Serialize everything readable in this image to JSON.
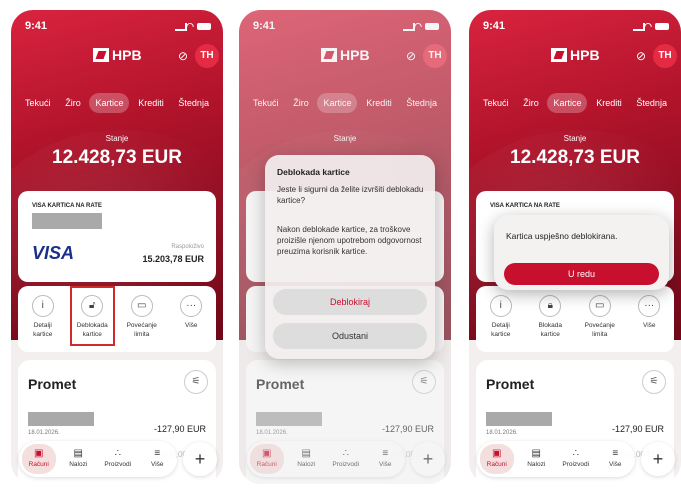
{
  "status": {
    "time": "9:41"
  },
  "header": {
    "logo_text": "HPB",
    "avatar_initials": "TH"
  },
  "tabs": [
    "Tekući",
    "Žiro",
    "Kartice",
    "Krediti",
    "Štednja"
  ],
  "balance": {
    "label": "Stanje",
    "amount": "12.428,73 EUR"
  },
  "card": {
    "title": "VISA KARTICA NA RATE",
    "brand": "VISA",
    "available_label": "Raspoloživo",
    "available_amount": "15.203,78 EUR"
  },
  "actions": [
    {
      "label": "Detalji\nkartice",
      "icon": "info-icon"
    },
    {
      "label": "Deblokada\nkartice",
      "icon": "unlock-icon"
    },
    {
      "label": "Povećanje\nlimita",
      "icon": "card-plus-icon"
    },
    {
      "label": "Više",
      "icon": "more-icon"
    }
  ],
  "actions_after": [
    {
      "label": "Detalji\nkartice"
    },
    {
      "label": "Blokada\nkartice"
    },
    {
      "label": "Povećanje\nlimita"
    },
    {
      "label": "Više"
    }
  ],
  "promet": {
    "title": "Promet",
    "date": "18.01.2026.",
    "amount": "-127,90 EUR",
    "amount2": "-100,00 EUR"
  },
  "nav": [
    "Računi",
    "Nalozi",
    "Proizvodi",
    "Više"
  ],
  "dialog": {
    "title": "Deblokada kartice",
    "question": "Jeste li sigurni da želite izvršiti deblokadu kartice?",
    "body": "Nakon deblokade kartice, za troškove proizišle njenom upotrebom odgovornost preuzima korisnik kartice.",
    "confirm": "Deblokiraj",
    "cancel": "Odustani"
  },
  "toast": {
    "message": "Kartica uspješno deblokirana.",
    "ok": "U redu"
  },
  "colors": {
    "brand": "#c8102e",
    "highlight": "#d12a2a"
  }
}
